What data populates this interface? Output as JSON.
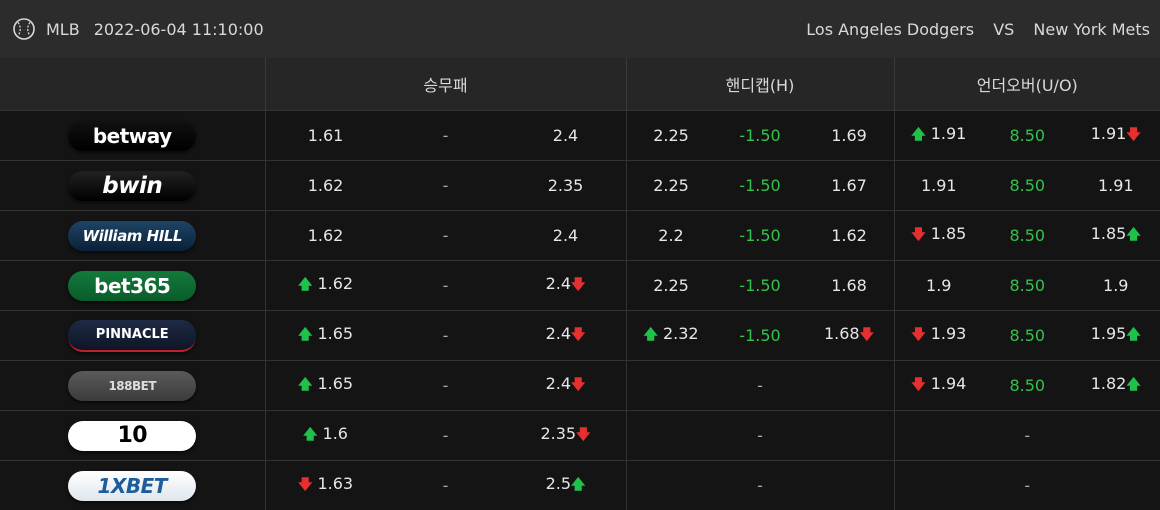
{
  "header": {
    "league": "MLB",
    "datetime": "2022-06-04 11:10:00",
    "home_team": "Los Angeles Dodgers",
    "vs": "VS",
    "away_team": "New York Mets"
  },
  "columns": {
    "moneyline": "승무패",
    "handicap": "핸디캡(H)",
    "overunder": "언더오버(U/O)"
  },
  "rows": [
    {
      "bookmaker": "betway",
      "ml": {
        "home": "1.61",
        "draw": "-",
        "away": "2.4",
        "home_trend": "",
        "away_trend": ""
      },
      "hc": {
        "home": "2.25",
        "line": "-1.50",
        "away": "1.69",
        "home_trend": "",
        "away_trend": ""
      },
      "ou": {
        "over": "1.91",
        "line": "8.50",
        "under": "1.91",
        "over_trend": "up",
        "under_trend": "down"
      }
    },
    {
      "bookmaker": "bwin",
      "ml": {
        "home": "1.62",
        "draw": "-",
        "away": "2.35",
        "home_trend": "",
        "away_trend": ""
      },
      "hc": {
        "home": "2.25",
        "line": "-1.50",
        "away": "1.67",
        "home_trend": "",
        "away_trend": ""
      },
      "ou": {
        "over": "1.91",
        "line": "8.50",
        "under": "1.91",
        "over_trend": "",
        "under_trend": ""
      }
    },
    {
      "bookmaker": "William HILL",
      "ml": {
        "home": "1.62",
        "draw": "-",
        "away": "2.4",
        "home_trend": "",
        "away_trend": ""
      },
      "hc": {
        "home": "2.2",
        "line": "-1.50",
        "away": "1.62",
        "home_trend": "",
        "away_trend": ""
      },
      "ou": {
        "over": "1.85",
        "line": "8.50",
        "under": "1.85",
        "over_trend": "down",
        "under_trend": "up"
      }
    },
    {
      "bookmaker": "bet365",
      "ml": {
        "home": "1.62",
        "draw": "-",
        "away": "2.4",
        "home_trend": "up",
        "away_trend": "down"
      },
      "hc": {
        "home": "2.25",
        "line": "-1.50",
        "away": "1.68",
        "home_trend": "",
        "away_trend": ""
      },
      "ou": {
        "over": "1.9",
        "line": "8.50",
        "under": "1.9",
        "over_trend": "",
        "under_trend": ""
      }
    },
    {
      "bookmaker": "PINNACLE",
      "ml": {
        "home": "1.65",
        "draw": "-",
        "away": "2.4",
        "home_trend": "up",
        "away_trend": "down"
      },
      "hc": {
        "home": "2.32",
        "line": "-1.50",
        "away": "1.68",
        "home_trend": "up",
        "away_trend": "down"
      },
      "ou": {
        "over": "1.93",
        "line": "8.50",
        "under": "1.95",
        "over_trend": "down",
        "under_trend": "up"
      }
    },
    {
      "bookmaker": "188BET",
      "ml": {
        "home": "1.65",
        "draw": "-",
        "away": "2.4",
        "home_trend": "up",
        "away_trend": "down"
      },
      "hc_empty": "-",
      "ou": {
        "over": "1.94",
        "line": "8.50",
        "under": "1.82",
        "over_trend": "down",
        "under_trend": "up"
      }
    },
    {
      "bookmaker": "10",
      "ml": {
        "home": "1.6",
        "draw": "-",
        "away": "2.35",
        "home_trend": "up",
        "away_trend": "down"
      },
      "hc_empty": "-",
      "ou_empty": "-"
    },
    {
      "bookmaker": "1XBET",
      "ml": {
        "home": "1.63",
        "draw": "-",
        "away": "2.5",
        "home_trend": "down",
        "away_trend": "up"
      },
      "hc_empty": "-",
      "ou_empty": "-"
    }
  ]
}
